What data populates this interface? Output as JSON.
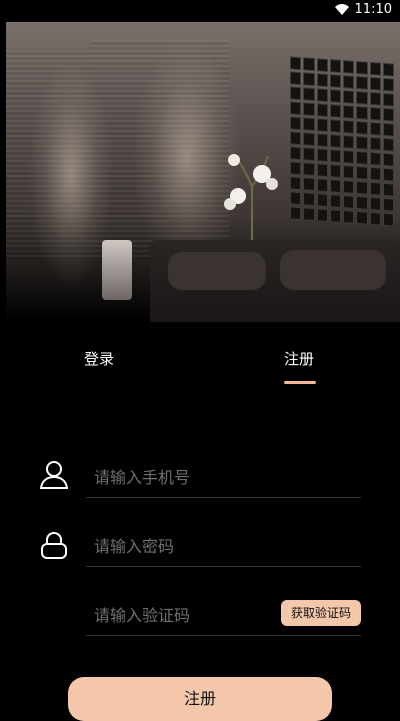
{
  "status_bar": {
    "time": "11:10",
    "wifi_icon": "wifi-icon"
  },
  "tabs": [
    {
      "label": "登录"
    },
    {
      "label": "注册"
    }
  ],
  "form": {
    "phone_placeholder": "请输入手机号",
    "password_placeholder": "请输入密码",
    "code_placeholder": "请输入验证码",
    "get_code_label": "获取验证码",
    "submit_label": "注册"
  },
  "icons": {
    "user": "user-icon",
    "lock": "lock-icon"
  },
  "colors": {
    "background": "#000000",
    "accent": "#f4c7ab",
    "tab_indicator": "#f4b896",
    "placeholder": "#6f6f6f"
  }
}
